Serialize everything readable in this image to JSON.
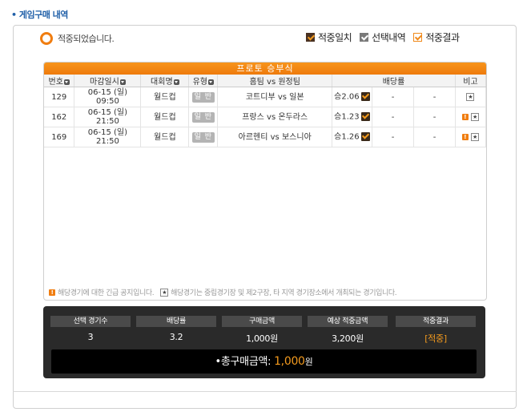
{
  "page_title": "• 게임구매 내역",
  "status_text": "적중되었습니다.",
  "legend": [
    {
      "label": "적중일치",
      "icon": "checked-dark-checkbox-icon"
    },
    {
      "label": "선택내역",
      "icon": "checked-gray-checkbox-icon"
    },
    {
      "label": "적중결과",
      "icon": "checked-outline-checkbox-icon"
    }
  ],
  "grid": {
    "title": "프로토 승부식",
    "columns": {
      "no": "번호",
      "deadline": "마감일시",
      "league": "대회명",
      "type": "유형",
      "match": "홈팀 vs 원정팀",
      "odds": "배당률",
      "note": "비고"
    },
    "rows": [
      {
        "no": "129",
        "date": "06-15 (일)",
        "time": "09:50",
        "league": "월드컵",
        "type": "일 반",
        "home": "코트디부",
        "vs": "vs",
        "away": "일본",
        "pick": "승",
        "odd": "2.06",
        "d1": "-",
        "d2": "-",
        "notes": [
          "star"
        ]
      },
      {
        "no": "162",
        "date": "06-15 (일)",
        "time": "21:50",
        "league": "월드컵",
        "type": "일 반",
        "home": "프랑스",
        "vs": "vs",
        "away": "온두라스",
        "pick": "승",
        "odd": "1.23",
        "d1": "-",
        "d2": "-",
        "notes": [
          "exclaim",
          "star"
        ]
      },
      {
        "no": "169",
        "date": "06-15 (일)",
        "time": "21:50",
        "league": "월드컵",
        "type": "일 반",
        "home": "아르헨티",
        "vs": "vs",
        "away": "보스니아",
        "pick": "승",
        "odd": "1.26",
        "d1": "-",
        "d2": "-",
        "notes": [
          "exclaim",
          "star"
        ]
      }
    ],
    "note_exclaim": "해당경기에 대한 긴급 공지입니다.",
    "note_star": "해당경기는 중립경기장 및 제2구장, 타 지역 경기장소에서 개최되는 경기입니다."
  },
  "summary": {
    "labels": [
      "선택 경기수",
      "배당률",
      "구매금액",
      "예상 적중금액",
      "적중결과"
    ],
    "values": [
      "3",
      "3.2",
      "1,000원",
      "3,200원",
      "[적중]"
    ],
    "total_label": "•총구매금액:",
    "total_amount": "1,000",
    "total_unit": "원"
  },
  "colors": {
    "accent": "#f07d10",
    "title_blue": "#1f5fa8",
    "summary_bg": "#2a2a2a"
  }
}
